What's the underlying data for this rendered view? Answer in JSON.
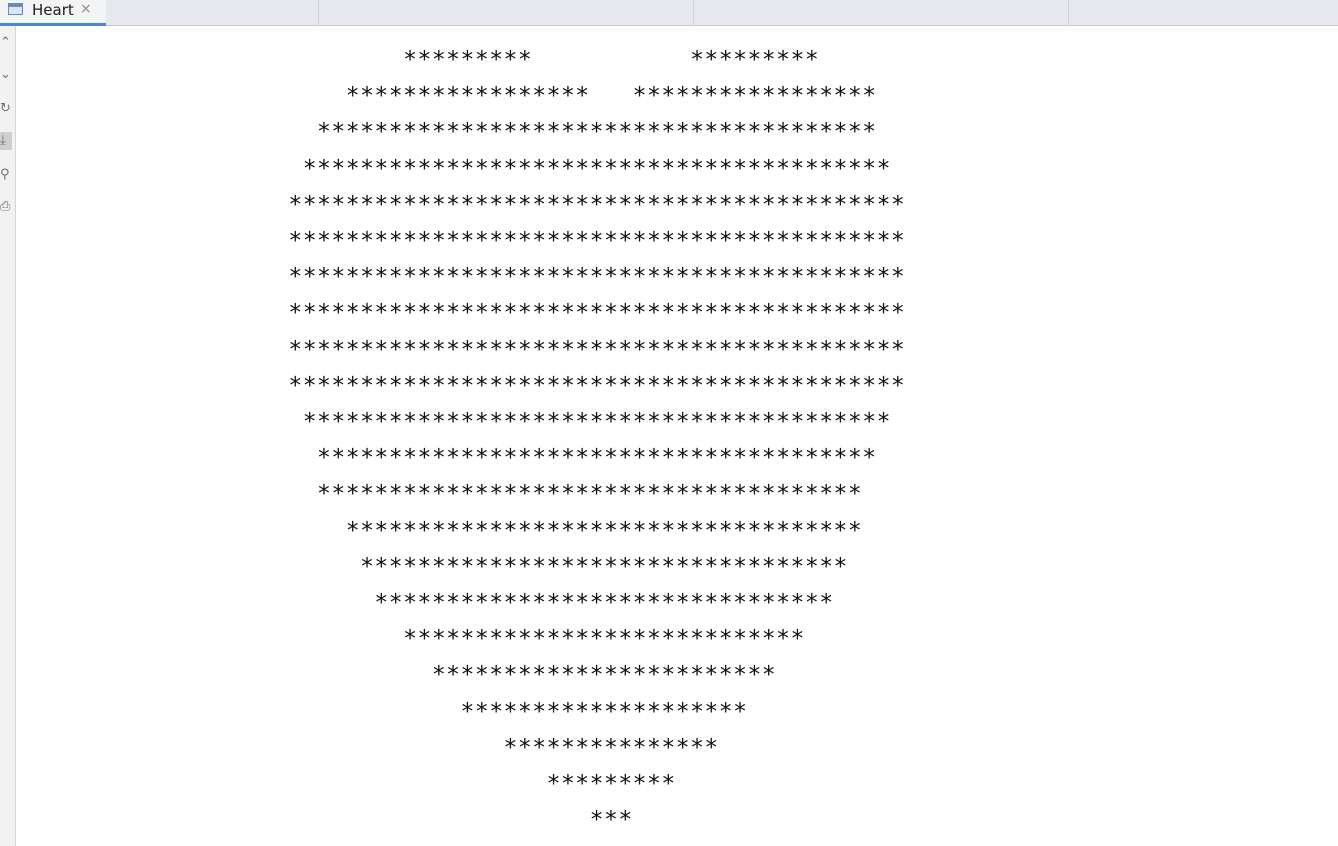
{
  "tab": {
    "title": "Heart",
    "close_glyph": "×",
    "icon": "console-window-icon"
  },
  "gutter": {
    "buttons": [
      {
        "name": "scroll-up-icon",
        "glyph": "⌃"
      },
      {
        "name": "scroll-down-icon",
        "glyph": "⌄"
      },
      {
        "name": "rerun-icon",
        "glyph": "↻"
      },
      {
        "name": "scroll-to-end-icon",
        "glyph": "⤓"
      },
      {
        "name": "pin-icon",
        "glyph": "⚲"
      },
      {
        "name": "print-icon",
        "glyph": "⎙"
      }
    ]
  },
  "console": {
    "lines": [
      "         *********           *********",
      "     *****************   *****************",
      "   ***************************************",
      "  *****************************************",
      " *******************************************",
      " *******************************************",
      " *******************************************",
      " *******************************************",
      " *******************************************",
      " *******************************************",
      "  *****************************************",
      "   ***************************************",
      "   **************************************",
      "     ************************************",
      "      **********************************",
      "       ********************************",
      "         ****************************",
      "           ************************",
      "             ********************",
      "                ***************",
      "                   *********",
      "                      ***"
    ]
  }
}
